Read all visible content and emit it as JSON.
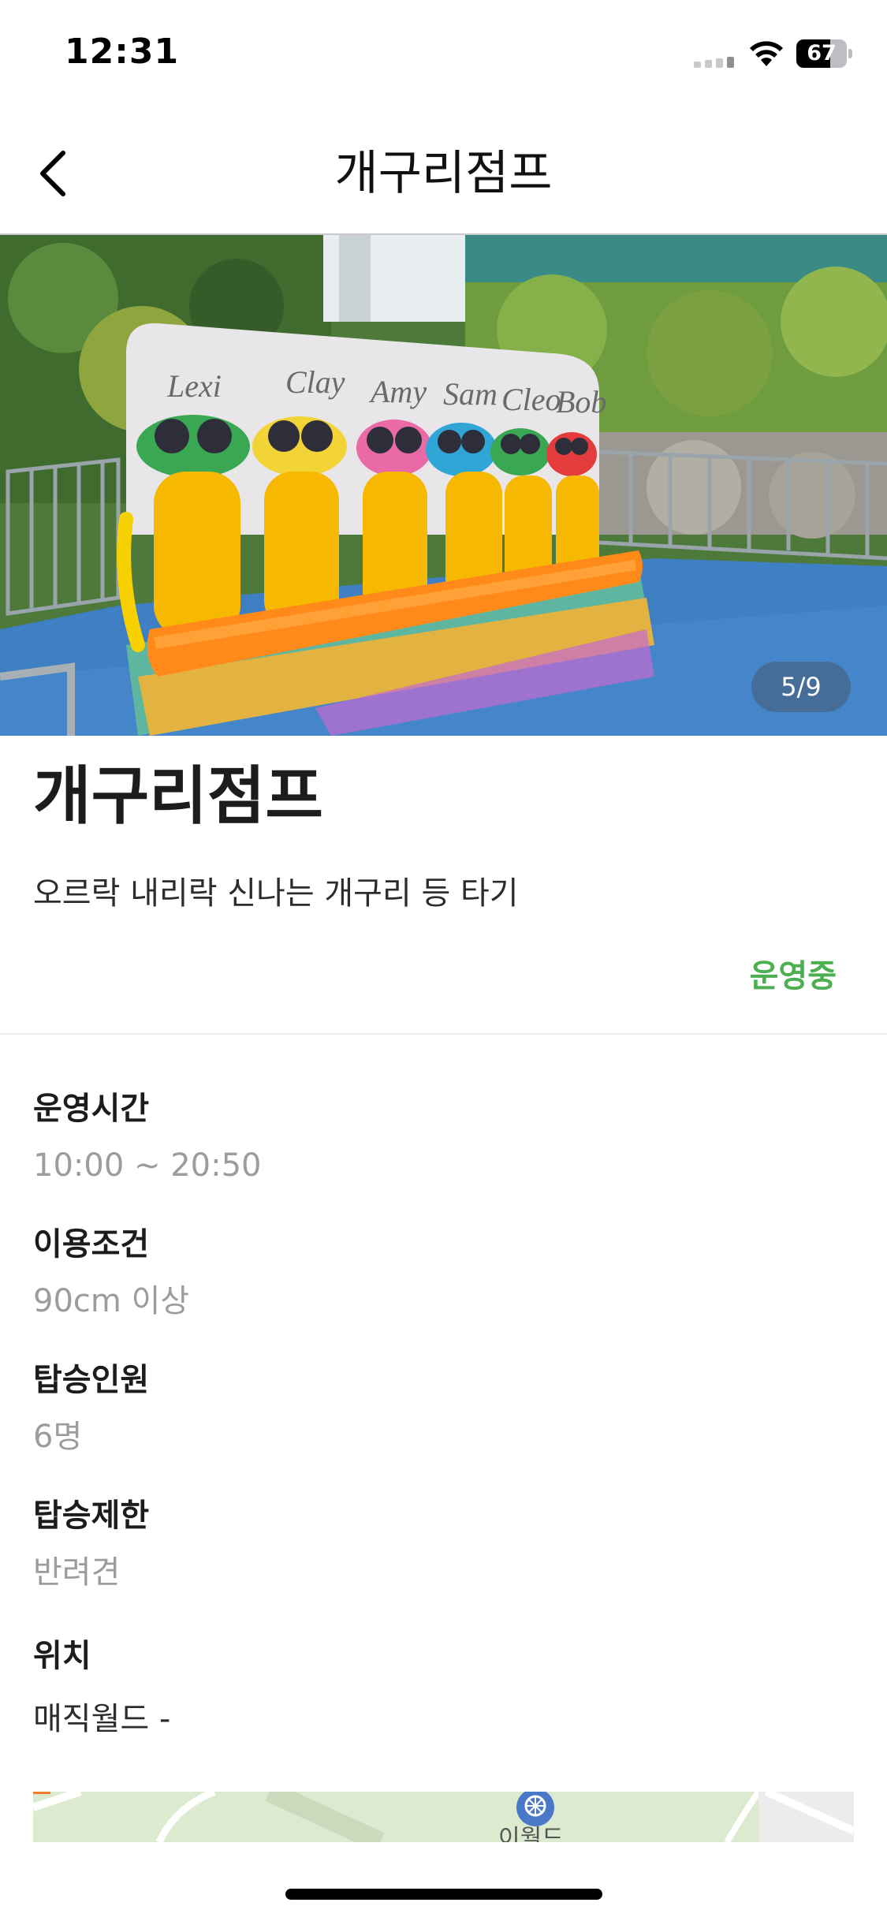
{
  "status_bar": {
    "time": "12:31",
    "battery_level": "67",
    "battery_fraction": 0.67,
    "icons": [
      "cell-signal-icon",
      "wifi-icon",
      "battery-icon"
    ]
  },
  "nav": {
    "title": "개구리점프",
    "back_icon": "chevron-left-icon"
  },
  "hero": {
    "page_indicator": "5/9",
    "seat_names": [
      "Lexi",
      "Clay",
      "Amy",
      "Sam",
      "Cleo",
      "Bob"
    ]
  },
  "ride": {
    "title": "개구리점프",
    "description": "오르락 내리락 신나는 개구리 등 타기",
    "status": "운영중",
    "status_color": "#4caf50"
  },
  "info": [
    {
      "label": "운영시간",
      "value": "10:00 ~ 20:50"
    },
    {
      "label": "이용조건",
      "value": "90cm 이상"
    },
    {
      "label": "탑승인원",
      "value": "6명"
    },
    {
      "label": "탑승제한",
      "value": "반려견"
    },
    {
      "label": "위치",
      "value": "매직월드 -"
    }
  ],
  "map": {
    "label": "이월드",
    "marker_icon": "ferris-wheel-icon"
  }
}
